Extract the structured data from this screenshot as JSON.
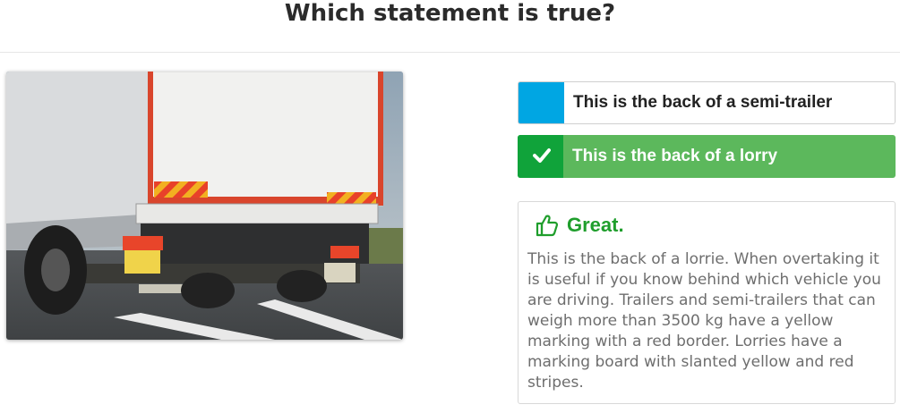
{
  "question": {
    "title": "Which statement is true?"
  },
  "image": {
    "icon": "truck-rear-photo"
  },
  "answers": [
    {
      "label": "This is the back of a semi-trailer",
      "state": "neutral",
      "marker_color": "#00a6e3"
    },
    {
      "label": "This is the back of a lorry",
      "state": "correct",
      "marker_color": "#10a33a",
      "icon": "check-icon"
    }
  ],
  "feedback": {
    "icon": "thumbs-up-icon",
    "title": "Great.",
    "text": "This is the back of a lorrie. When overtaking it is useful if you know behind which vehicle you are driving. Trailers and semi-trailers that can weigh more than 3500 kg have a yellow marking with a red border. Lorries have a marking board with slanted yellow and red stripes."
  },
  "colors": {
    "correct": "#5cb85c",
    "accent": "#00a6e3",
    "success_text": "#1f9e2c"
  }
}
